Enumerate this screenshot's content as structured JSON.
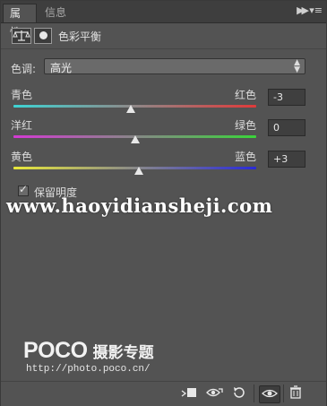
{
  "tabs": {
    "active": "属性",
    "inactive": "信息"
  },
  "tabbar_icons": {
    "collapse": "double-chevron-right-icon",
    "menu": "panel-menu-icon"
  },
  "header": {
    "title": "色彩平衡",
    "icons": [
      "color-balance-icon",
      "layer-mask-icon"
    ]
  },
  "tone": {
    "label": "色调:",
    "value": "高光"
  },
  "sliders": [
    {
      "left_label": "青色",
      "right_label": "红色",
      "value": "-3",
      "level": -3,
      "range": [
        -100,
        100
      ],
      "colors": [
        "#3ed4d4",
        "#e03a3a"
      ]
    },
    {
      "left_label": "洋红",
      "right_label": "绿色",
      "value": "0",
      "level": 0,
      "range": [
        -100,
        100
      ],
      "colors": [
        "#d43ad4",
        "#3ad43a"
      ]
    },
    {
      "left_label": "黄色",
      "right_label": "蓝色",
      "value": "+3",
      "level": 3,
      "range": [
        -100,
        100
      ],
      "colors": [
        "#e8e83a",
        "#2a2ad8"
      ]
    }
  ],
  "preserve_luminosity": {
    "label": "保留明度",
    "checked": true
  },
  "watermark": {
    "site": "www.haoyidiansheji.com",
    "brand": "POCO",
    "brand_cn": "摄影专题",
    "url": "http://photo.poco.cn/"
  },
  "bottom_icons": [
    "clip-to-layer-icon",
    "view-previous-state-icon",
    "reset-icon",
    "visibility-eye-icon",
    "trash-icon"
  ]
}
